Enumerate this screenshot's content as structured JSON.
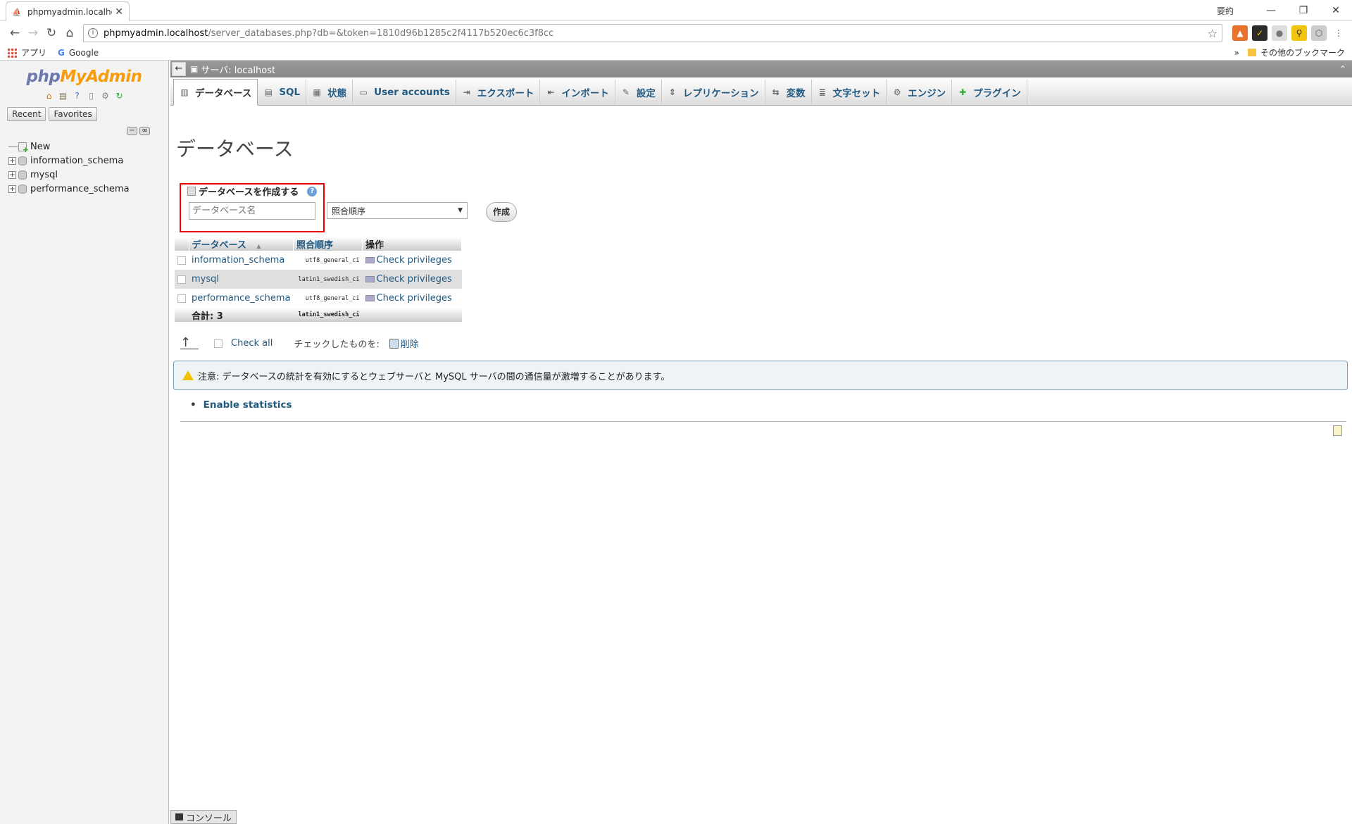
{
  "browser": {
    "tab_title": "phpmyadmin.localhost",
    "user_badge": "要約",
    "url_host": "phpmyadmin.localhost",
    "url_path": "/server_databases.php?db=&token=1810d96b1285c2f4117b520ec6c3f8cc",
    "bookmarks": {
      "apps": "アプリ",
      "google": "Google",
      "overflow": "»",
      "other": "その他のブックマーク"
    }
  },
  "nav": {
    "logo_php": "php",
    "logo_my": "My",
    "logo_admin": "Admin",
    "recent": "Recent",
    "favorites": "Favorites",
    "tree": [
      {
        "label": "New"
      },
      {
        "label": "information_schema"
      },
      {
        "label": "mysql"
      },
      {
        "label": "performance_schema"
      }
    ]
  },
  "server": {
    "label": "サーバ: localhost"
  },
  "tabs": [
    {
      "label": "データベース",
      "icon": "database-icon"
    },
    {
      "label": "SQL",
      "icon": "sql-icon"
    },
    {
      "label": "状態",
      "icon": "status-icon"
    },
    {
      "label": "User accounts",
      "icon": "users-icon"
    },
    {
      "label": "エクスポート",
      "icon": "export-icon"
    },
    {
      "label": "インポート",
      "icon": "import-icon"
    },
    {
      "label": "設定",
      "icon": "settings-icon"
    },
    {
      "label": "レプリケーション",
      "icon": "replication-icon"
    },
    {
      "label": "変数",
      "icon": "variables-icon"
    },
    {
      "label": "文字セット",
      "icon": "charset-icon"
    },
    {
      "label": "エンジン",
      "icon": "engine-icon"
    },
    {
      "label": "プラグイン",
      "icon": "plugin-icon"
    }
  ],
  "page": {
    "title": "データベース",
    "create": {
      "heading": "データベースを作成する",
      "name_placeholder": "データベース名",
      "collation_selected": "照合順序",
      "button": "作成"
    },
    "table": {
      "headers": {
        "database": "データベース",
        "sort_indicator": "▲",
        "collation": "照合順序",
        "action": "操作"
      },
      "rows": [
        {
          "name": "information_schema",
          "collation": "utf8_general_ci",
          "action": "Check privileges"
        },
        {
          "name": "mysql",
          "collation": "latin1_swedish_ci",
          "action": "Check privileges"
        },
        {
          "name": "performance_schema",
          "collation": "utf8_general_ci",
          "action": "Check privileges"
        }
      ],
      "total_label": "合計: 3",
      "total_collation": "latin1_swedish_ci"
    },
    "bulk": {
      "check_all": "Check all",
      "with_selected": "チェックしたものを:",
      "delete": "削除"
    },
    "notice": "注意: データベースの統計を有効にするとウェブサーバと MySQL サーバの間の通信量が激増することがあります。",
    "enable_stats": "Enable statistics"
  },
  "console": "コンソール"
}
